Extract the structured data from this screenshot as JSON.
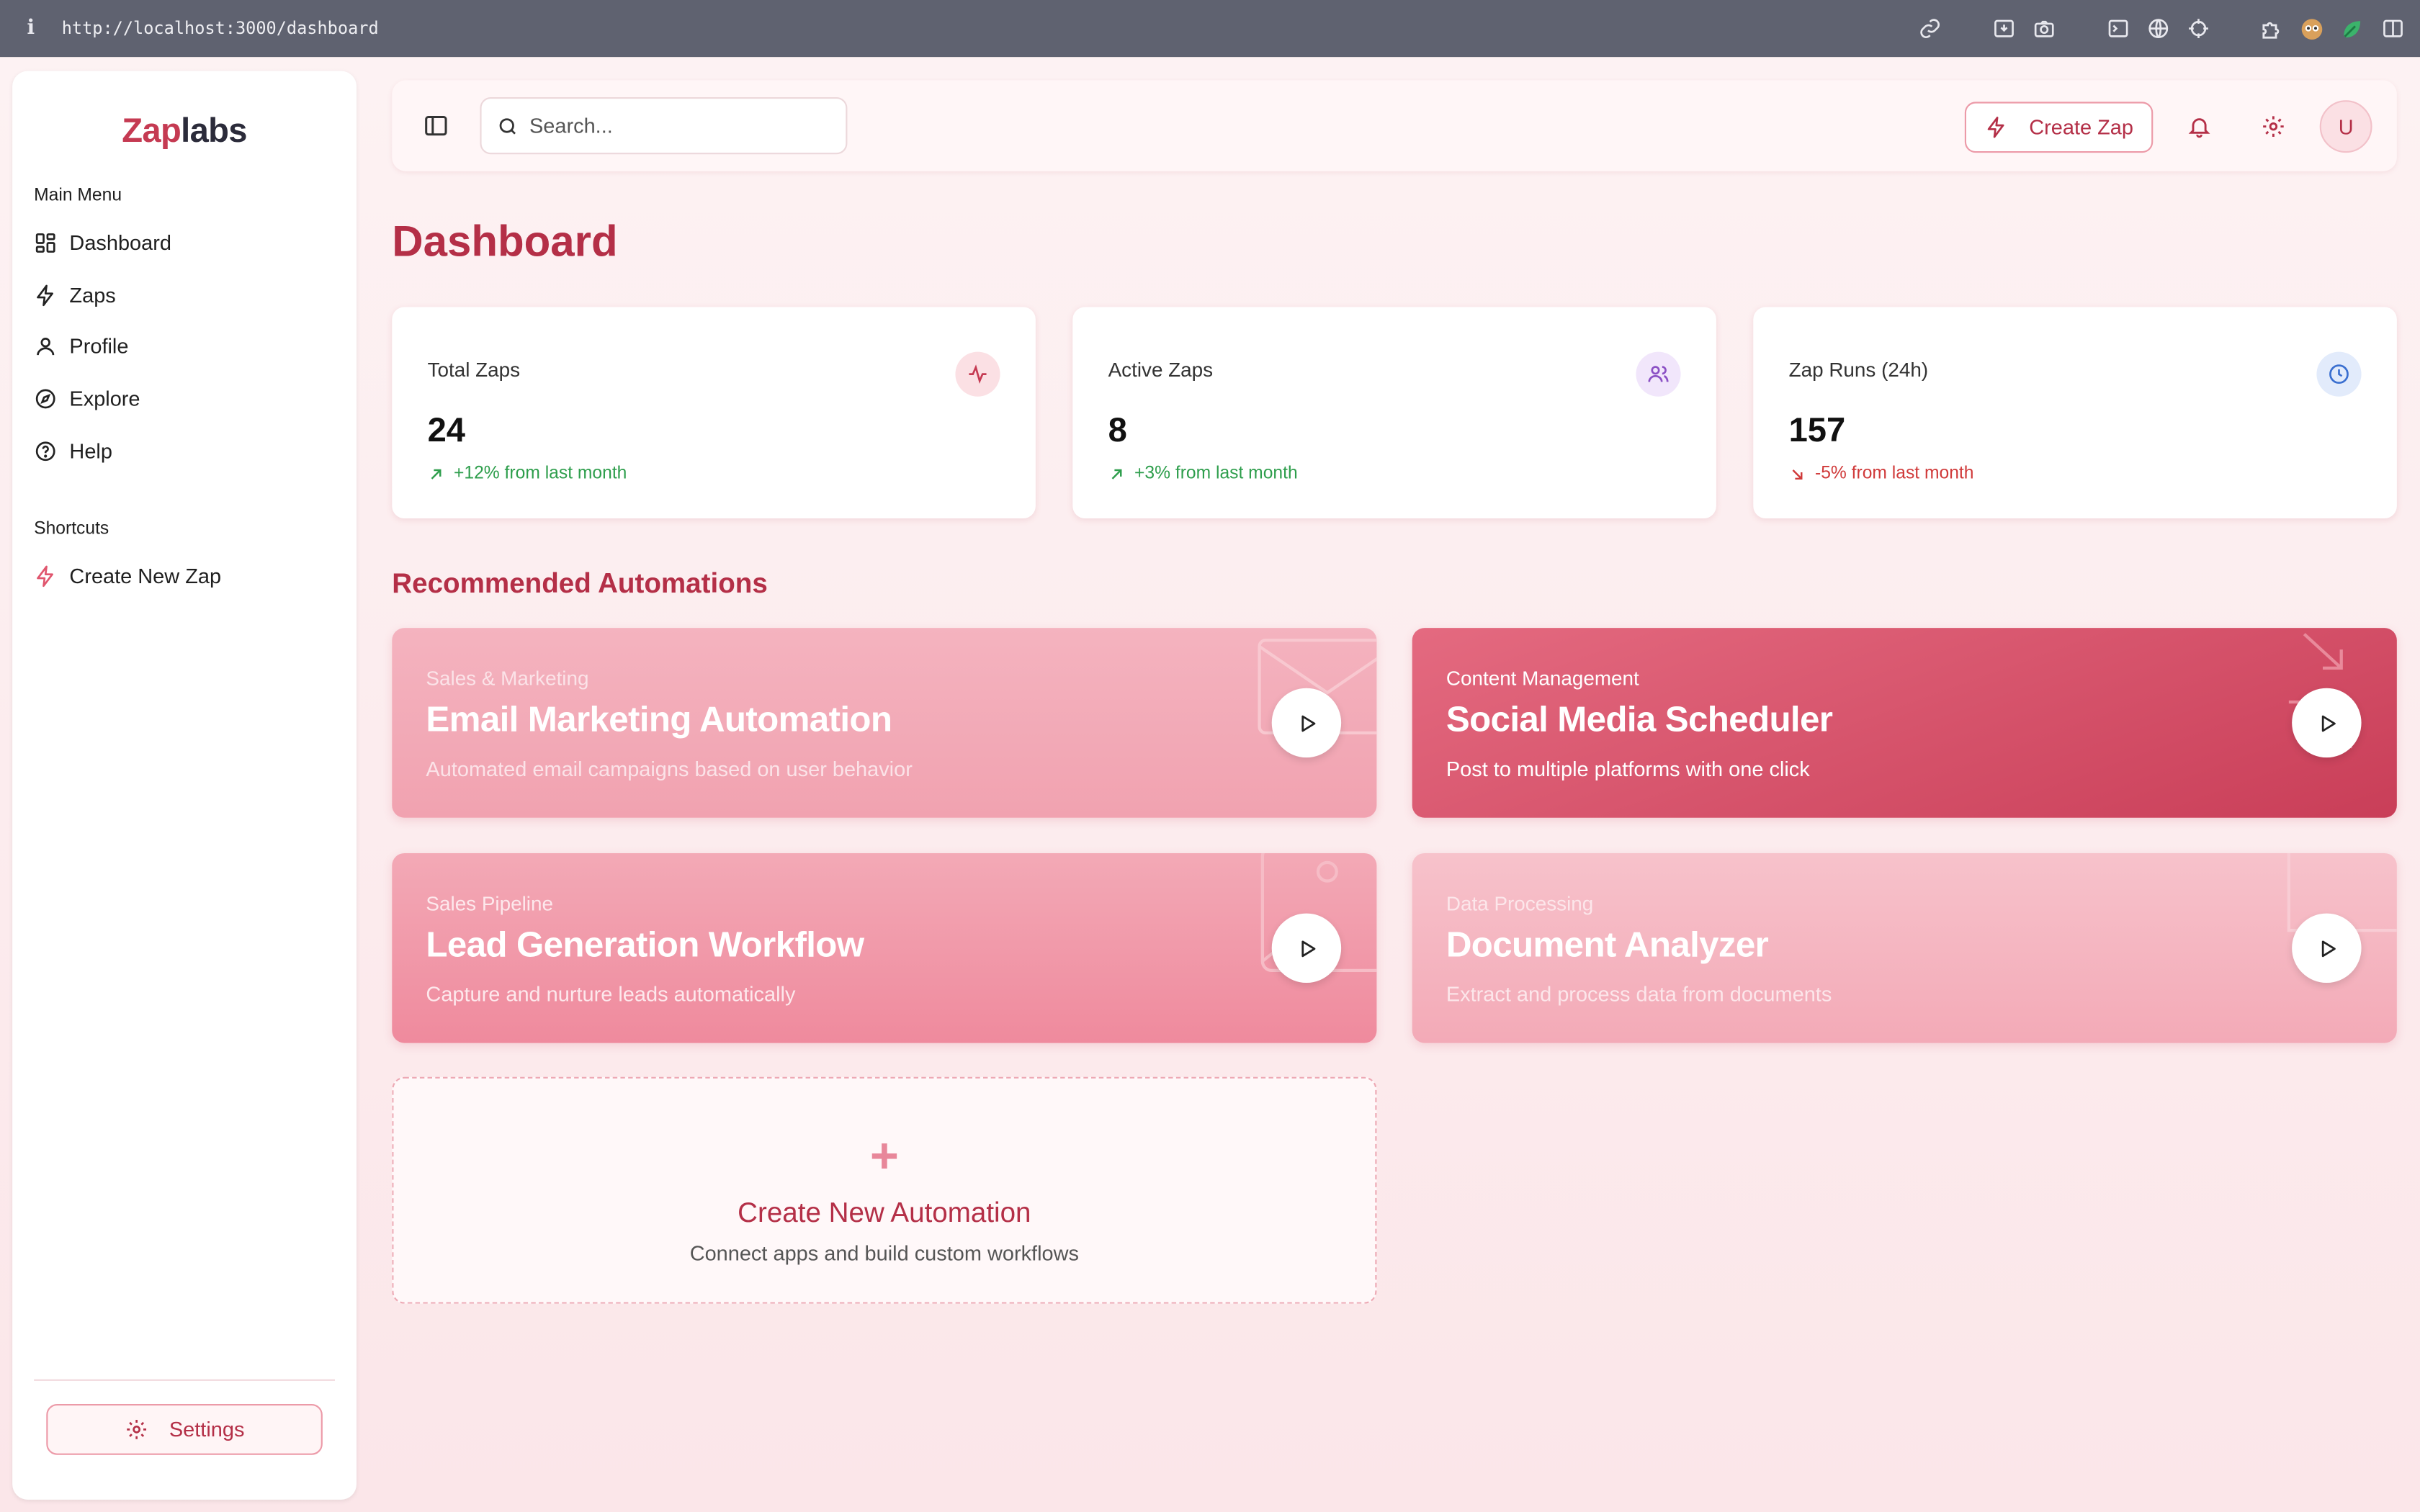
{
  "browser": {
    "info_glyph": "i",
    "url": "http://localhost:3000/dashboard"
  },
  "sidebar": {
    "logo_part1": "Zap",
    "logo_part2": "labs",
    "main_menu_label": "Main Menu",
    "items": [
      {
        "label": "Dashboard",
        "icon": "dashboard-grid-icon"
      },
      {
        "label": "Zaps",
        "icon": "lightning-icon"
      },
      {
        "label": "Profile",
        "icon": "user-icon"
      },
      {
        "label": "Explore",
        "icon": "compass-icon"
      },
      {
        "label": "Help",
        "icon": "help-circle-icon"
      }
    ],
    "shortcuts_label": "Shortcuts",
    "shortcuts": [
      {
        "label": "Create New Zap",
        "icon": "lightning-icon"
      }
    ],
    "settings_label": "Settings"
  },
  "topbar": {
    "search_placeholder": "Search...",
    "create_label": "Create Zap",
    "avatar_initial": "U"
  },
  "page": {
    "title": "Dashboard"
  },
  "stats": [
    {
      "label": "Total Zaps",
      "value": "24",
      "delta": "+12% from last month",
      "trend": "up",
      "icon": "activity-icon"
    },
    {
      "label": "Active Zaps",
      "value": "8",
      "delta": "+3% from last month",
      "trend": "up",
      "icon": "users-icon"
    },
    {
      "label": "Zap Runs (24h)",
      "value": "157",
      "delta": "-5% from last month",
      "trend": "down",
      "icon": "clock-icon"
    }
  ],
  "recommended": {
    "title": "Recommended Automations",
    "cards": [
      {
        "category": "Sales & Marketing",
        "title": "Email Marketing Automation",
        "description": "Automated email campaigns based on user behavior"
      },
      {
        "category": "Content Management",
        "title": "Social Media Scheduler",
        "description": "Post to multiple platforms with one click"
      },
      {
        "category": "Sales Pipeline",
        "title": "Lead Generation Workflow",
        "description": "Capture and nurture leads automatically"
      },
      {
        "category": "Data Processing",
        "title": "Document Analyzer",
        "description": "Extract and process data from documents"
      }
    ]
  },
  "new_automation": {
    "plus": "+",
    "title": "Create New Automation",
    "description": "Connect apps and build custom workflows"
  },
  "colors": {
    "accent": "#b42f47",
    "positive": "#2e9e4c",
    "negative": "#d03a3a",
    "page_bg": "#fce8ea"
  }
}
